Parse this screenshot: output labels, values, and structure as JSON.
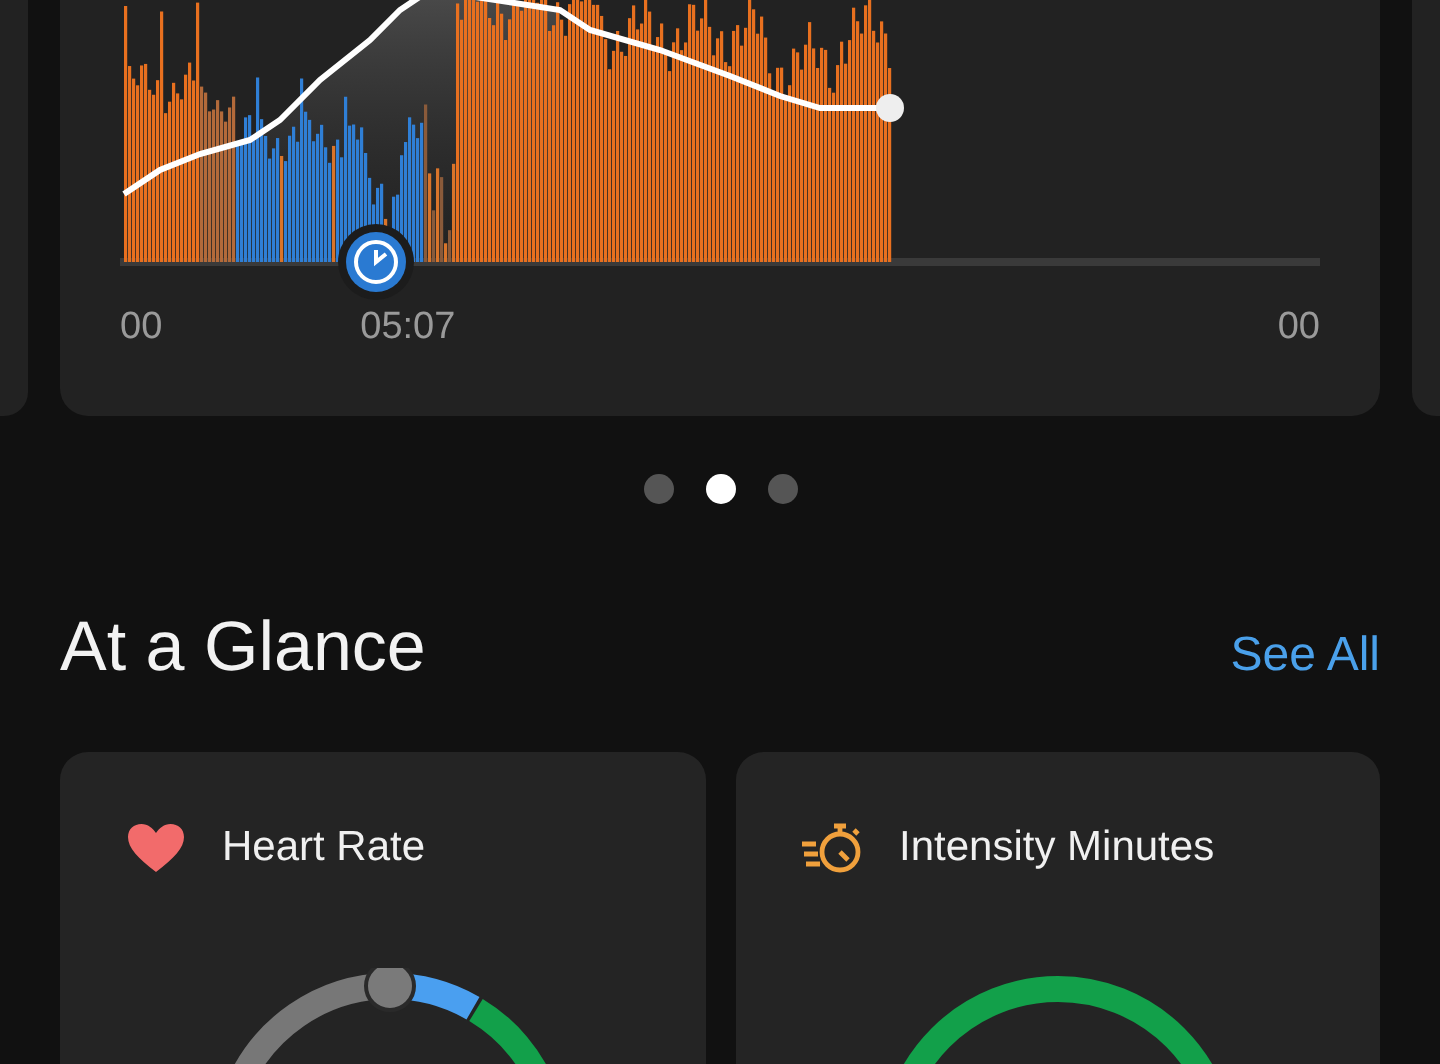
{
  "chart": {
    "x_labels": [
      "00",
      "05:07",
      "00"
    ]
  },
  "pager": {
    "dots": [
      {
        "selected": false
      },
      {
        "selected": true
      },
      {
        "selected": false
      }
    ]
  },
  "section": {
    "title": "At a Glance",
    "link": "See All"
  },
  "cards": [
    {
      "kind": "heart_rate",
      "title": "Heart Rate"
    },
    {
      "kind": "intensity",
      "title": "Intensity Minutes"
    }
  ]
}
